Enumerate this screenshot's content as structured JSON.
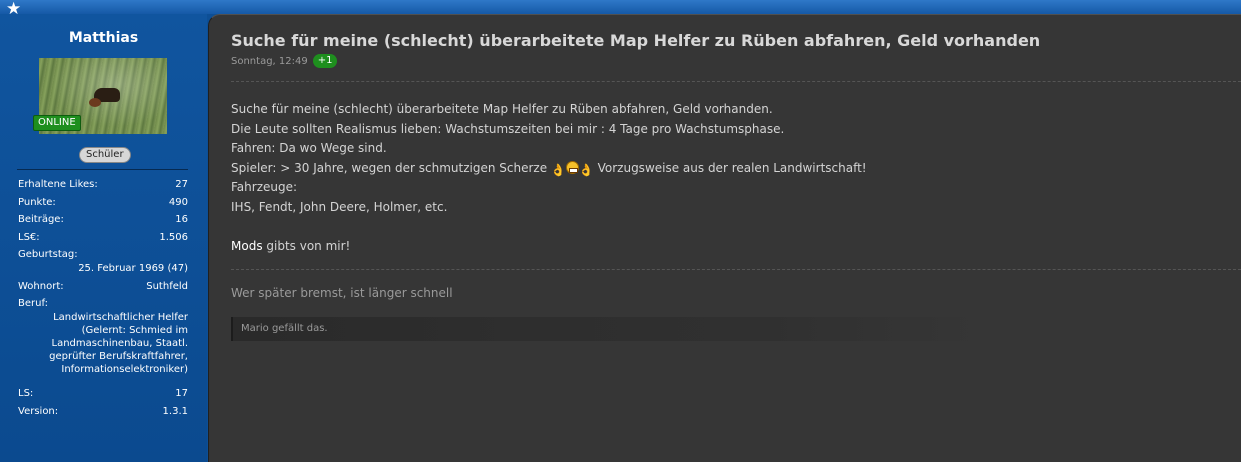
{
  "header": {
    "star_icon": "star-icon"
  },
  "sidebar": {
    "username": "Matthias",
    "online_label": "ONLINE",
    "rank_label": "Schüler",
    "stats": [
      {
        "label": "Erhaltene Likes:",
        "value": "27"
      },
      {
        "label": "Punkte:",
        "value": "490"
      },
      {
        "label": "Beiträge:",
        "value": "16"
      },
      {
        "label": "LS€:",
        "value": "1.506"
      },
      {
        "label": "Geburtstag:",
        "value": "25. Februar 1969 (47)"
      },
      {
        "label": "Wohnort:",
        "value": "Suthfeld"
      },
      {
        "label": "Beruf:",
        "value": "Landwirtschaftlicher Helfer (Gelernt: Schmied im Landmaschinenbau, Staatl. geprüfter Berufskraftfahrer, Informationselektroniker)"
      },
      {
        "label": "LS:",
        "value": "17"
      },
      {
        "label": "Version:",
        "value": "1.3.1"
      }
    ]
  },
  "post": {
    "title": "Suche für meine (schlecht) überarbeitete Map Helfer zu Rüben abfahren, Geld vorhanden",
    "time": "Sonntag, 12:49",
    "like_count": "+1",
    "lines": {
      "l1": "Suche für meine (schlecht) überarbeitete Map Helfer zu Rüben abfahren, Geld vorhanden.",
      "l2": "Die Leute sollten Realismus lieben: Wachstumszeiten bei mir : 4 Tage pro Wachstumsphase.",
      "l3": "Fahren: Da wo Wege sind.",
      "l4_before": "Spieler: > 30 Jahre, wegen der schmutzigen Scherze ",
      "l4_after": " Vorzugsweise aus der realen Landwirtschaft!",
      "l5": "Fahrzeuge:",
      "l6": "IHS, Fendt, John Deere, Holmer, etc.",
      "l7_strong": "Mods",
      "l7_rest": " gibts von mir!"
    },
    "emoji_hand": "👌",
    "signature": "Wer später bremst, ist länger schnell",
    "likes_text": "Mario gefällt das."
  },
  "colors": {
    "sidebar_bg": "#0d4f96",
    "content_bg": "#363636",
    "online_green": "#1e8f1e"
  }
}
